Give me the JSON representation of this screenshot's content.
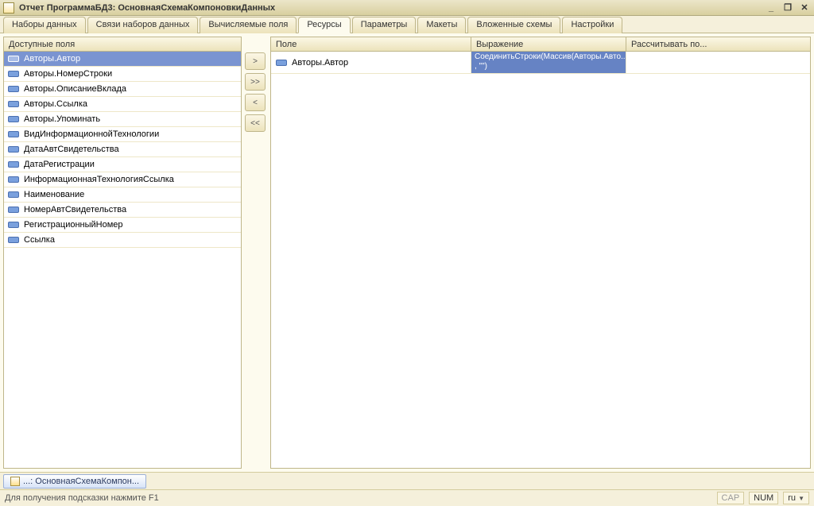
{
  "window": {
    "title": "Отчет ПрограммаБД3: ОсновнаяСхемаКомпоновкиДанных"
  },
  "tabs": {
    "items": [
      "Наборы данных",
      "Связи наборов данных",
      "Вычисляемые поля",
      "Ресурсы",
      "Параметры",
      "Макеты",
      "Вложенные схемы",
      "Настройки"
    ],
    "activeIndex": 3
  },
  "leftPanel": {
    "header": "Доступные поля",
    "fields": [
      {
        "label": "Авторы.Автор",
        "selected": true
      },
      {
        "label": "Авторы.НомерСтроки",
        "selected": false
      },
      {
        "label": "Авторы.ОписаниеВклада",
        "selected": false
      },
      {
        "label": "Авторы.Ссылка",
        "selected": false
      },
      {
        "label": "Авторы.Упоминать",
        "selected": false
      },
      {
        "label": "ВидИнформационнойТехнологии",
        "selected": false
      },
      {
        "label": "ДатаАвтСвидетельства",
        "selected": false
      },
      {
        "label": "ДатаРегистрации",
        "selected": false
      },
      {
        "label": "ИнформационнаяТехнологияСсылка",
        "selected": false
      },
      {
        "label": "Наименование",
        "selected": false
      },
      {
        "label": "НомерАвтСвидетельства",
        "selected": false
      },
      {
        "label": "РегистрационныйНомер",
        "selected": false
      },
      {
        "label": "Ссылка",
        "selected": false
      }
    ]
  },
  "midButtons": {
    "addOne": ">",
    "addAll": ">>",
    "removeOne": "<",
    "removeAll": "<<"
  },
  "rightTable": {
    "headers": {
      "field": "Поле",
      "expression": "Выражение",
      "calc": "Рассчитывать по..."
    },
    "rows": [
      {
        "field": "Авторы.Автор",
        "expression": "СоединитьСтроки(Массив(Авторы.Авто... , \"\")",
        "calc": ""
      }
    ]
  },
  "docbar": {
    "label": "...: ОсновнаяСхемаКомпон..."
  },
  "statusbar": {
    "hint": "Для получения подсказки нажмите F1",
    "cap": "CAP",
    "num": "NUM",
    "lang": "ru"
  }
}
